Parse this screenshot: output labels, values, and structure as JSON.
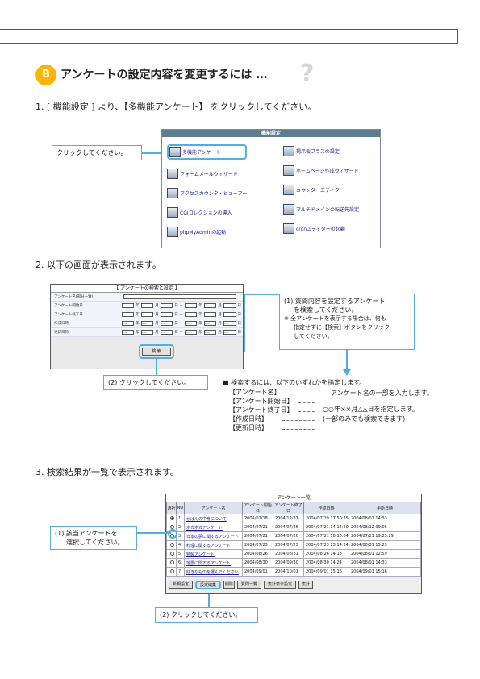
{
  "section": {
    "badge": "B",
    "title": "アンケートの設定内容を変更するには …",
    "qmark": "?"
  },
  "step1": {
    "text": "1. [ 機能設定 ] より、【多機能アンケート】 をクリックしてください。",
    "callout": "クリックしてください。",
    "window": {
      "title": "機能設定",
      "left_items": [
        "多機能アンケート",
        "フォームメールウィザード",
        "アクセスカウンタ・ビューアー",
        "CGIコレクションの導入",
        "phpMyAdminの起動"
      ],
      "right_items": [
        "掲示板プラスの設定",
        "ホームページ作成ウィザード",
        "カウンターエディター",
        "マルチドメインの転送先設定",
        "cronエディターの起動"
      ]
    }
  },
  "step2": {
    "text": "2. 以下の画面が表示されます。",
    "form": {
      "title": "【 アンケートの検索と設定 】",
      "rows": [
        "アンケート名(部分一致)",
        "アンケート開始日",
        "アンケート終了日",
        "作成日時",
        "更新日時"
      ],
      "sel": "----",
      "units": [
        "年",
        "月",
        "日",
        "~"
      ],
      "search_button": "検 索"
    },
    "callout1": [
      "(1) 質問内容を設定するアンケート",
      "を検索してください。",
      "※ 全アンケートを表示する場合は、何も",
      "指定せずに【検索】ボタンをクリック",
      "してください。"
    ],
    "callout2": "(2) クリックしてください。",
    "note": {
      "head": "■ 検索するには、以下のいずれかを指定します。",
      "items": [
        "【アンケート名】",
        "【アンケート開始日】",
        "【アンケート終了日】",
        "【作成日時】",
        "【更新日時】"
      ],
      "desc1": "アンケート名の一部を入力します。",
      "desc2": "○○年××月△△日を指定します。",
      "desc3": "(一部のみでも検索できます)"
    }
  },
  "step3": {
    "text": "3. 検索結果が一覧で表示されます。",
    "table_title": "アンケート一覧",
    "headers": [
      "選択",
      "NO",
      "アンケート名",
      "アンケート開始日",
      "アンケート終了日",
      "作成日時",
      "更新日時"
    ],
    "rows": [
      [
        "1",
        "かばんの中身について",
        "2004/07/18",
        "2004/12/31",
        "2004/07/29 17:50:35",
        "2004/08/01 14:33"
      ],
      [
        "2",
        "ホカホカアンケート",
        "2004/07/21",
        "2004/07/26",
        "2004/07/21 14:14:20",
        "2004/08/12 09:05"
      ],
      [
        "3",
        "日本の夢に関するアンケート",
        "2004/07/21",
        "2004/07/26",
        "2004/07/21 18:10:04",
        "2004/07/21 19:25:29"
      ],
      [
        "4",
        "料理に関するアンケート",
        "2004/07/23",
        "2004/07/23",
        "2004/07/23 13:14:24",
        "2004/08/31 15:23"
      ],
      [
        "5",
        "特製アンケート",
        "2004/08/26",
        "2004/08/31",
        "2004/08/26 14:18",
        "2004/08/01 12:59"
      ],
      [
        "6",
        "地震に関するアンケート",
        "2004/08/30",
        "2004/09/30",
        "2004/08/30 14:24",
        "2004/08/01 14:33"
      ],
      [
        "7",
        "好きなものを選んでください",
        "2004/09/01",
        "2004/10/01",
        "2004/09/01 15:16",
        "2004/09/01 15:16"
      ]
    ],
    "buttons": [
      "新規設定",
      "設定編集",
      "削除",
      "質問一覧",
      "集計表示設定",
      "集計"
    ],
    "callout1": [
      "(1) 該当アンケートを",
      "選択してください。"
    ],
    "callout2": "(2) クリックしてください。"
  }
}
